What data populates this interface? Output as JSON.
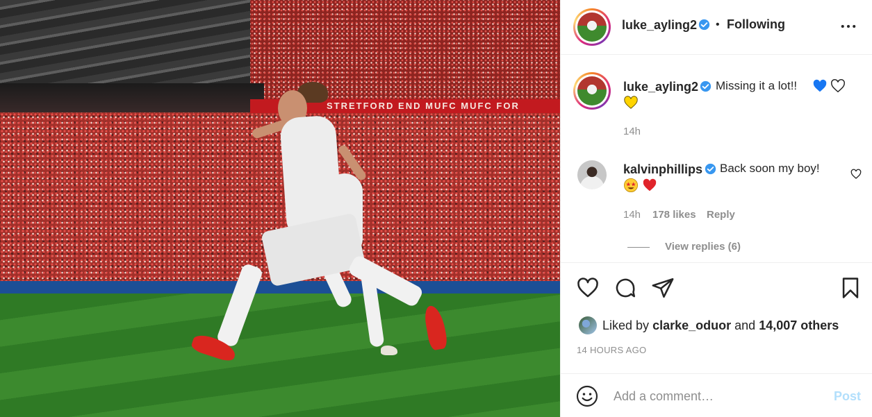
{
  "post": {
    "author": "luke_ayling2",
    "follow_separator": "•",
    "follow_status": "Following",
    "more_icon": "more-options-icon",
    "caption": {
      "username": "luke_ayling2",
      "text": "Missing it a lot!!",
      "emojis": [
        "blue-heart",
        "white-heart",
        "yellow-heart"
      ],
      "time": "14h"
    },
    "photo_banner": "STRETFORD END   MUFC   MUFC FOR"
  },
  "comments": [
    {
      "username": "kalvinphillips",
      "text": "Back soon my boy!",
      "emojis": [
        "star-struck",
        "red-heart"
      ],
      "time": "14h",
      "likes": "178 likes",
      "reply_label": "Reply",
      "view_replies": "View replies (6)"
    }
  ],
  "actions": {
    "icons": [
      "heart-icon",
      "comment-icon",
      "share-icon",
      "bookmark-icon"
    ],
    "liked_prefix": "Liked by",
    "liked_user": "clarke_oduor",
    "liked_and": "and",
    "liked_others": "14,007 others",
    "posted_ago": "14 HOURS AGO"
  },
  "add_comment": {
    "placeholder": "Add a comment…",
    "post_label": "Post"
  },
  "colors": {
    "verified": "#3897f0",
    "post_disabled": "#b2dffc",
    "muted": "#8e8e8e",
    "text": "#262626"
  }
}
